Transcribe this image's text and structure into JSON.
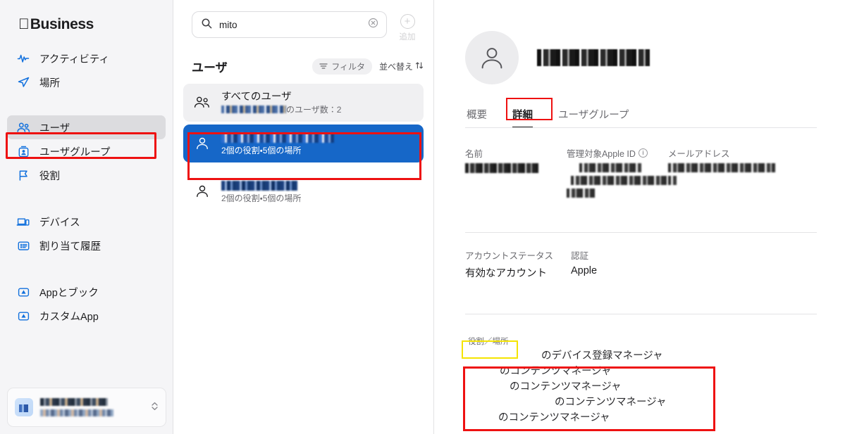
{
  "sidebar": {
    "brand": {
      "apple_glyph": "",
      "text": "Business"
    },
    "groups": [
      {
        "items": [
          {
            "label": "アクティビティ",
            "icon": "activity-waveform-icon"
          },
          {
            "label": "場所",
            "icon": "paper-plane-icon"
          }
        ]
      },
      {
        "items": [
          {
            "label": "ユーザ",
            "icon": "users-icon",
            "active": true
          },
          {
            "label": "ユーザグループ",
            "icon": "id-badge-icon"
          },
          {
            "label": "役割",
            "icon": "flag-icon"
          }
        ]
      },
      {
        "items": [
          {
            "label": "デバイス",
            "icon": "devices-icon"
          },
          {
            "label": "割り当て履歴",
            "icon": "assignment-history-icon"
          }
        ]
      },
      {
        "items": [
          {
            "label": "Appとブック",
            "icon": "app-store-icon"
          },
          {
            "label": "カスタムApp",
            "icon": "app-store-icon"
          }
        ]
      }
    ],
    "account": {
      "name_redacted": "",
      "org_redacted": "",
      "chevron": "⌃⌄"
    }
  },
  "list_panel": {
    "search": {
      "value": "mito",
      "placeholder": "",
      "icon": "search-icon",
      "clear_icon": "clear-circle-icon"
    },
    "add_button": {
      "label": "追加",
      "icon": "plus-circle-icon"
    },
    "title": "ユーザ",
    "filter": {
      "label": "フィルタ",
      "icon": "filter-icon"
    },
    "sort": {
      "label": "並べ替え",
      "icon": "sort-arrows-icon"
    },
    "rows": [
      {
        "type": "group",
        "title": "すべてのユーザ",
        "subtitle_suffix": "のユーザ数：2",
        "icon": "users-pair-icon",
        "selected": false
      },
      {
        "type": "user",
        "title_redacted": "",
        "subtitle": "2個の役割・5個の場所",
        "icon": "person-icon",
        "selected": true
      },
      {
        "type": "user",
        "title_redacted": "",
        "subtitle": "2個の役割・5個の場所",
        "icon": "person-icon",
        "selected": false
      }
    ]
  },
  "detail": {
    "avatar_icon": "person-icon",
    "name_redacted": "",
    "tabs": [
      {
        "label": "概要",
        "active": false
      },
      {
        "label": "詳細",
        "active": true
      },
      {
        "label": "ユーザグループ",
        "active": false
      }
    ],
    "fields_row1": [
      {
        "label": "名前",
        "value_redacted": "",
        "has_info": false
      },
      {
        "label": "管理対象Apple ID",
        "value_redacted": "",
        "has_info": true,
        "info_icon": "info-circle-icon"
      },
      {
        "label": "メールアドレス",
        "value_redacted": "",
        "has_info": false
      }
    ],
    "fields_row2": [
      {
        "label": "アカウントステータス",
        "value": "有効なアカウント"
      },
      {
        "label": "認証",
        "value": "Apple"
      }
    ],
    "roles_section": {
      "label": "役割／場所",
      "lines": [
        {
          "prefix_redacted": "LOCATION",
          "text": "のデバイス登録マネージャ",
          "indent": 108
        },
        {
          "prefix_redacted": "LOCATION",
          "text": "のコンテンツマネージャ",
          "indent": 49
        },
        {
          "prefix_redacted": "LOCATION",
          "text": "のコンテンツマネージャ",
          "indent": 63
        },
        {
          "prefix_redacted": "LOCATION",
          "text": "のコンテンツマネージャ",
          "indent": 127
        },
        {
          "prefix_redacted": "LOCATION",
          "text": "のコンテンツマネージャ",
          "indent": 47
        }
      ]
    }
  },
  "annotations": {
    "nav_users_box_color": "#ee1111",
    "selected_row_box_color": "#ee1111",
    "detail_tab_box_color": "#ee1111",
    "roles_label_box_color": "#f5e400",
    "roles_list_box_color": "#ee1111"
  },
  "colors": {
    "selection_blue": "#1667c8",
    "sidebar_bg": "#f5f5f7",
    "icon_blue": "#1170dd"
  }
}
